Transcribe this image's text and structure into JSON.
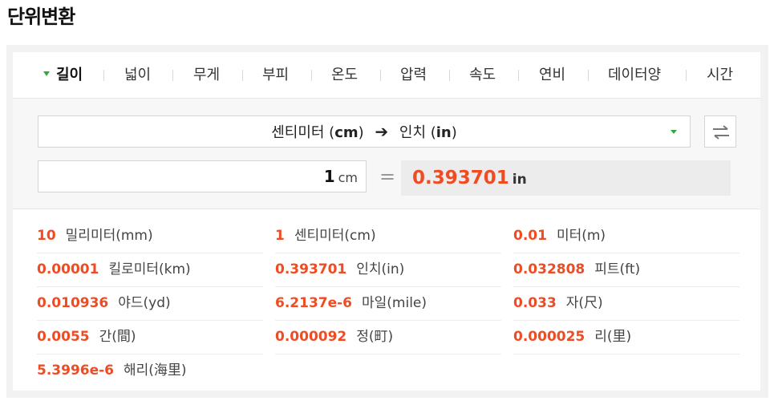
{
  "page_title": "단위변환",
  "tabs": [
    {
      "label": "길이",
      "active": true
    },
    {
      "label": "넓이"
    },
    {
      "label": "무게"
    },
    {
      "label": "부피"
    },
    {
      "label": "온도"
    },
    {
      "label": "압력"
    },
    {
      "label": "속도"
    },
    {
      "label": "연비"
    },
    {
      "label": "데이터양"
    },
    {
      "label": "시간"
    }
  ],
  "converter": {
    "from_name": "센티미터",
    "from_abbr": "cm",
    "to_name": "인치",
    "to_abbr": "in",
    "input_value": "1",
    "input_unit": "cm",
    "equals": "=",
    "result_value": "0.393701",
    "result_unit": "in"
  },
  "colors": {
    "accent_green": "#35a83d",
    "value_orange": "#f04c24"
  },
  "conversions": [
    {
      "value": "10",
      "unit": "밀리미터(mm)"
    },
    {
      "value": "1",
      "unit": "센티미터(cm)"
    },
    {
      "value": "0.01",
      "unit": "미터(m)"
    },
    {
      "value": "0.00001",
      "unit": "킬로미터(km)"
    },
    {
      "value": "0.393701",
      "unit": "인치(in)"
    },
    {
      "value": "0.032808",
      "unit": "피트(ft)"
    },
    {
      "value": "0.010936",
      "unit": "야드(yd)"
    },
    {
      "value": "6.2137e-6",
      "unit": "마일(mile)"
    },
    {
      "value": "0.033",
      "unit": "자(尺)"
    },
    {
      "value": "0.0055",
      "unit": "간(間)"
    },
    {
      "value": "0.000092",
      "unit": "정(町)"
    },
    {
      "value": "0.000025",
      "unit": "리(里)"
    },
    {
      "value": "5.3996e-6",
      "unit": "해리(海里)"
    }
  ]
}
